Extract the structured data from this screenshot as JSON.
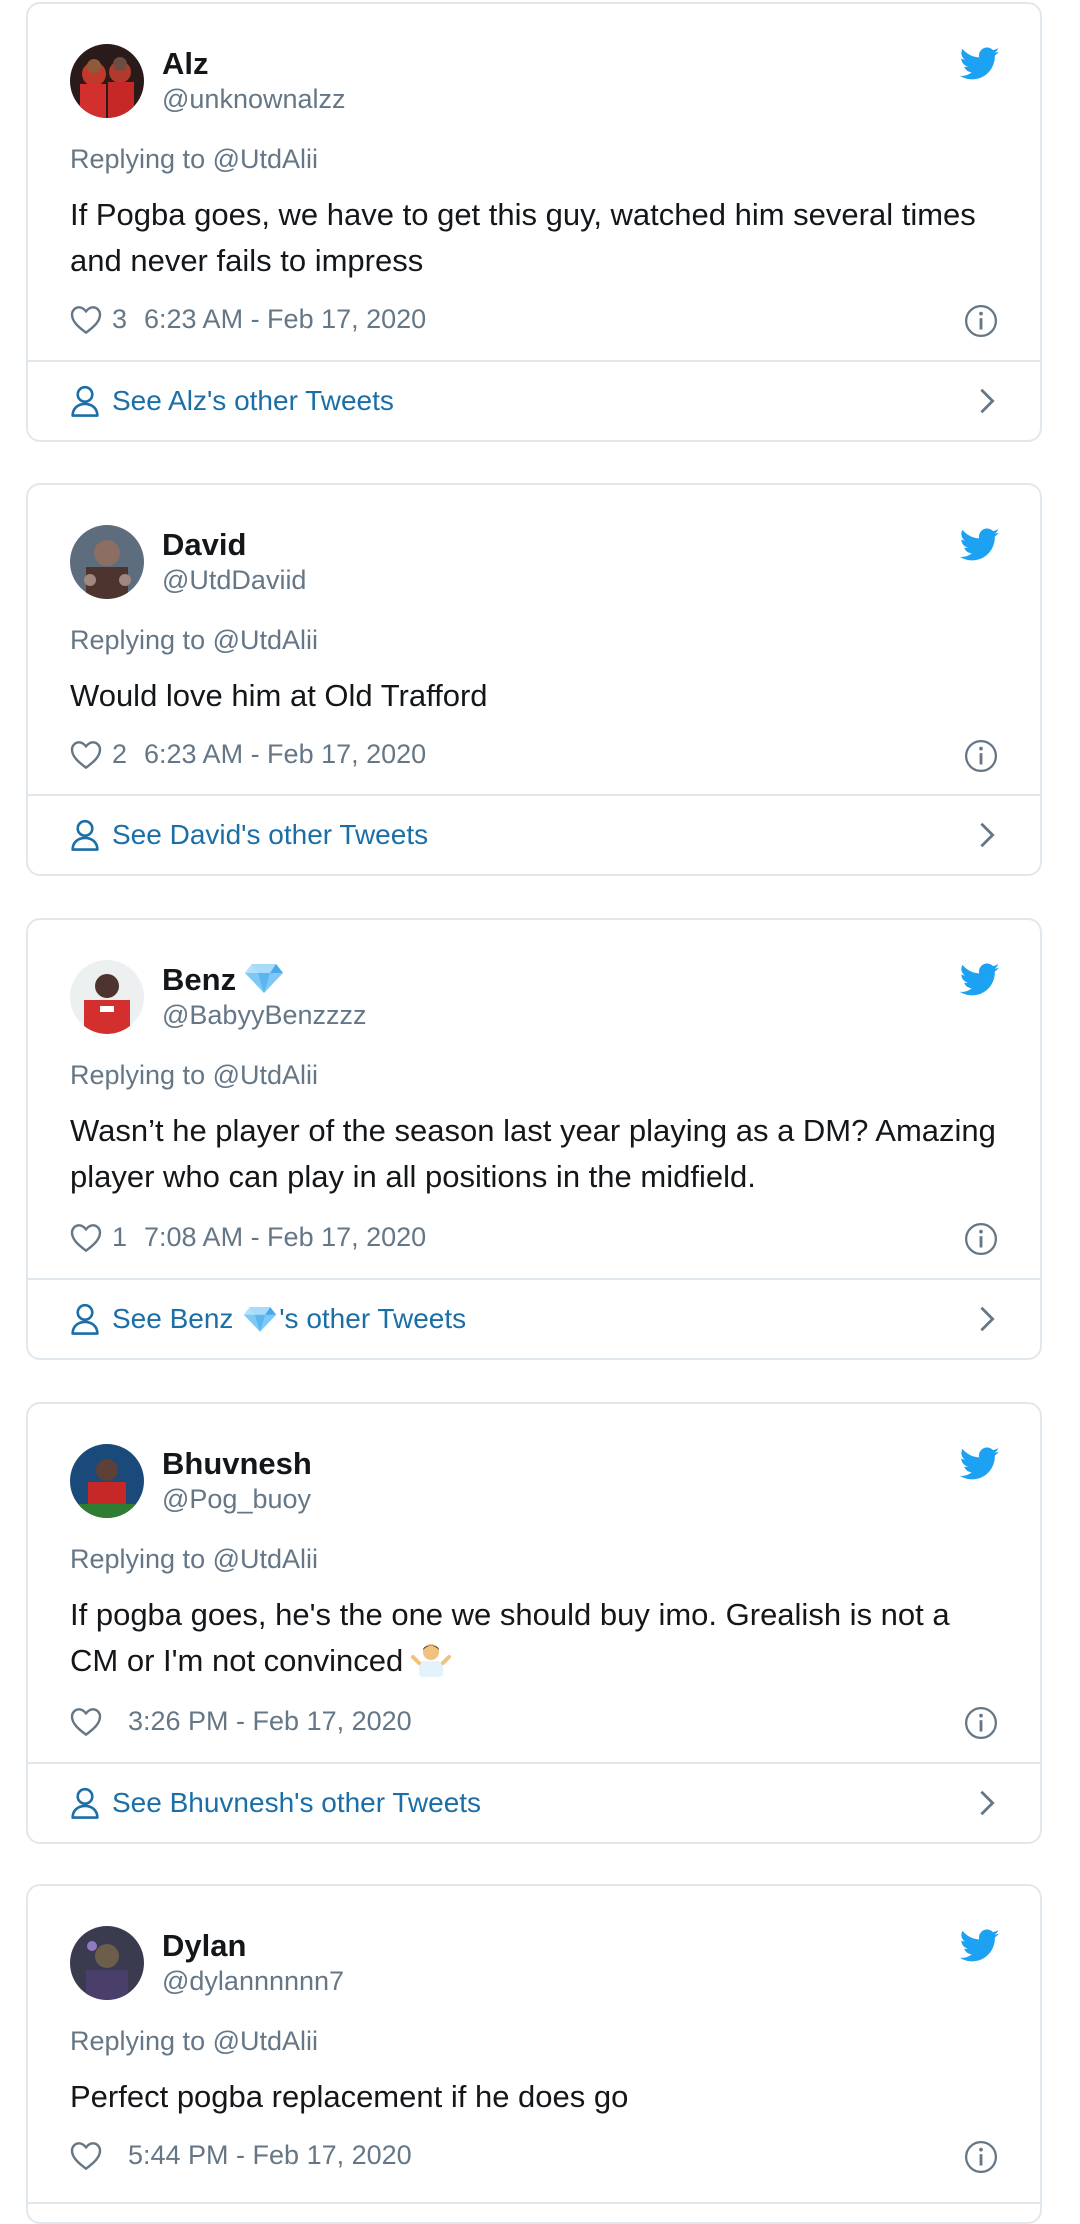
{
  "tweets": [
    {
      "name": "Alz",
      "handle": "@unknownalzz",
      "replying": "Replying to @UtdAlii",
      "text": "If Pogba goes, we have to get this guy, watched him several times and never fails to impress",
      "likes": "3",
      "time": "6:23 AM - Feb 17, 2020",
      "footer_prefix": "See Alz's other Tweets",
      "footer_suffix": ""
    },
    {
      "name": "David",
      "handle": "@UtdDaviid",
      "replying": "Replying to @UtdAlii",
      "text": "Would love him at Old Trafford",
      "likes": "2",
      "time": "6:23 AM - Feb 17, 2020",
      "footer_prefix": "See David's other Tweets",
      "footer_suffix": ""
    },
    {
      "name": "Benz",
      "handle": "@BabyyBenzzzz",
      "replying": "Replying to @UtdAlii",
      "text": "Wasn’t he player of the season last year playing as a DM? Amazing player who can play in all positions in the midfield.",
      "likes": "1",
      "time": "7:08 AM - Feb 17, 2020",
      "footer_prefix": "See Benz ",
      "footer_suffix": "'s other Tweets"
    },
    {
      "name": "Bhuvnesh",
      "handle": "@Pog_buoy",
      "replying": "Replying to @UtdAlii",
      "text": "If pogba goes, he's the one we should buy imo. Grealish is not a CM or I'm not convinced",
      "likes": "",
      "time": "3:26 PM - Feb 17, 2020",
      "footer_prefix": "See Bhuvnesh's other Tweets",
      "footer_suffix": ""
    },
    {
      "name": "Dylan",
      "handle": "@dylannnnnn7",
      "replying": "Replying to @UtdAlii",
      "text": "Perfect pogba replacement if he does go",
      "likes": "",
      "time": "5:44 PM - Feb 17, 2020",
      "footer_prefix": "",
      "footer_suffix": ""
    }
  ],
  "colors": {
    "twitter_blue": "#1da1f2",
    "link_blue": "#1b6fa6",
    "border": "#e1e8ed",
    "muted": "#657786"
  },
  "icons": [
    "twitter-bird-icon",
    "heart-icon",
    "info-icon",
    "user-icon",
    "chevron-right-icon",
    "gem-emoji",
    "shrug-emoji"
  ]
}
